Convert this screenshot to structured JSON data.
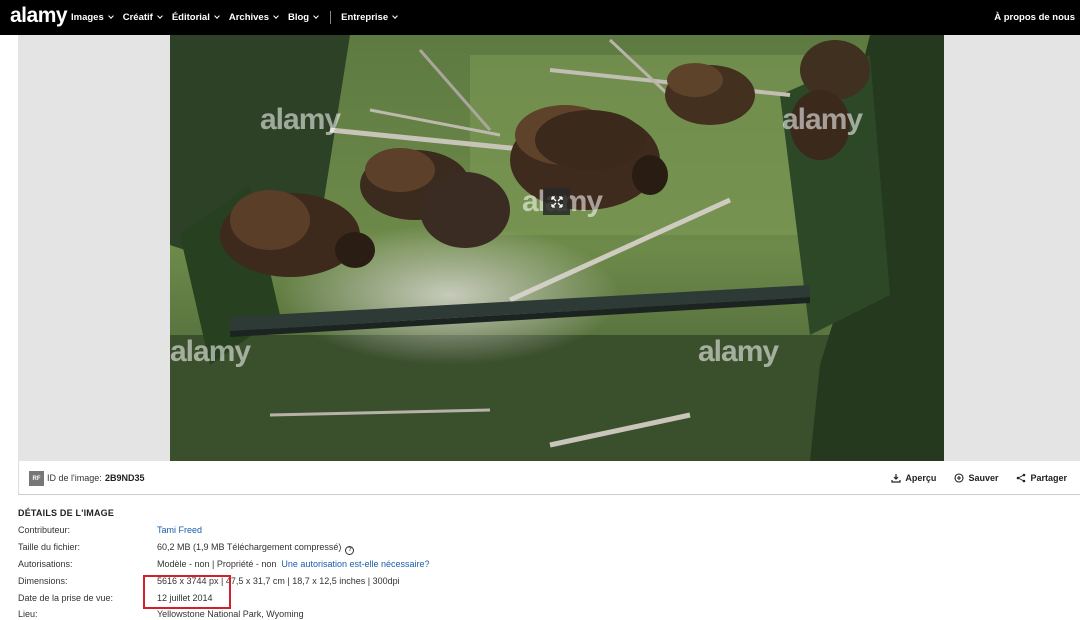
{
  "header": {
    "logo": "alamy",
    "nav": [
      "Images",
      "Créatif",
      "Éditorial",
      "Archives",
      "Blog"
    ],
    "nav_after_sep": [
      "Entreprise"
    ],
    "about": "À propos de nous"
  },
  "viewer": {
    "watermark": "alamy"
  },
  "actionbar": {
    "rf_badge": "RF",
    "image_id_label": "ID de l'image:",
    "image_id_value": "2B9ND35",
    "preview": "Aperçu",
    "save": "Sauver",
    "share": "Partager"
  },
  "details": {
    "title": "DÉTAILS DE L'IMAGE",
    "contributor_label": "Contributeur:",
    "contributor_value": "Tami Freed",
    "filesize_label": "Taille du fichier:",
    "filesize_value": "60,2 MB (1,9 MB Téléchargement compressé)",
    "filesize_info": "?",
    "releases_label": "Autorisations:",
    "releases_value": "Modèle - non | Propriété - non",
    "releases_link": "Une autorisation est-elle nécessaire?",
    "dimensions_label": "Dimensions:",
    "dimensions_value": "5616 x 3744 px | 47,5 x 31,7 cm | 18,7 x 12,5 inches | 300dpi",
    "date_label": "Date de la prise de vue:",
    "date_value": "12 juillet 2014",
    "location_label": "Lieu:",
    "location_value": "Yellowstone National Park, Wyoming"
  }
}
